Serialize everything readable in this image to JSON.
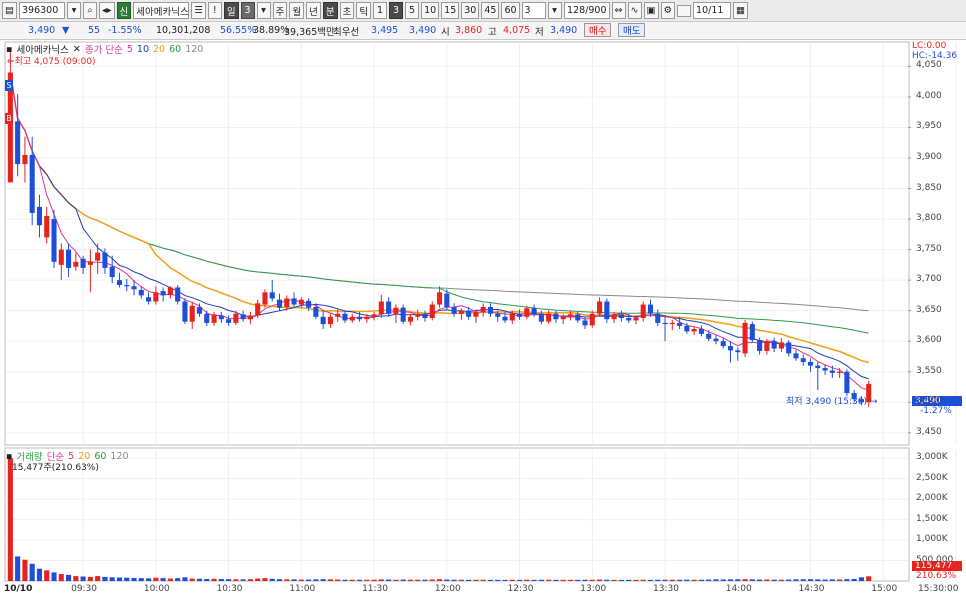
{
  "toolbar": {
    "code": "396300",
    "name": "세아메카닉스",
    "badge": "신",
    "alert": "!",
    "period_day": "일",
    "period_num": "3",
    "periods": [
      "주",
      "월",
      "년"
    ],
    "minute_label": "분",
    "intervals": [
      "초",
      "틱",
      "1",
      "3",
      "5",
      "10",
      "15",
      "30",
      "45",
      "60"
    ],
    "interval_value": "3",
    "count": "128",
    "count_total": "/900",
    "date": "10/11"
  },
  "quote": {
    "price": "3,490",
    "change": "55",
    "rate": "-1.55%",
    "volume": "10,301,208",
    "ratio1": "56.55%",
    "ratio2": "38.89%",
    "amount": "39,365백만",
    "best_label": "최우선",
    "best_ask": "3,495",
    "best_bid": "3,490",
    "open_label": "시",
    "open": "3,860",
    "high_label": "고",
    "high": "4,075",
    "low_label": "저",
    "low": "3,490",
    "buy": "매수",
    "sell": "매도"
  },
  "price_panel": {
    "title": "세아메카닉스",
    "ma_label": "종가 단순",
    "ma_periods": [
      "5",
      "10",
      "20",
      "60",
      "120"
    ],
    "high_note": "최고 4,075 (09:00)",
    "low_note": "최저 3,490 (15:30)",
    "lc": "LC:0.00",
    "hc": "HC:-14.36",
    "current_price": "3,490",
    "current_rate": "-1.27%",
    "s_marker": "S",
    "b_marker": "B",
    "y_ticks": [
      "4,050",
      "4,000",
      "3,950",
      "3,900",
      "3,850",
      "3,800",
      "3,750",
      "3,700",
      "3,650",
      "3,600",
      "3,550",
      "3,500",
      "3,450"
    ]
  },
  "volume_panel": {
    "title": "거래량",
    "ma_label": "단순",
    "ma_periods": [
      "5",
      "20",
      "60",
      "120"
    ],
    "max_note": "15,477주(210.63%)",
    "current_volume": "115,477",
    "current_rate": "210.63%",
    "y_ticks": [
      "3,000K",
      "2,500K",
      "2,000K",
      "1,500K",
      "1,000K",
      "500,000"
    ]
  },
  "x_axis": {
    "date": "10/10",
    "times": [
      "09:30",
      "10:00",
      "10:30",
      "11:00",
      "11:30",
      "12:00",
      "12:30",
      "13:00",
      "13:30",
      "14:00",
      "14:30",
      "15:00",
      "15:30:00"
    ]
  },
  "colors": {
    "up": "#e8231e",
    "down": "#1d4fd8",
    "ma5": "#e0309a",
    "ma10": "#1f3fb8",
    "ma20": "#f0a01a",
    "ma60": "#2e9a4a",
    "ma120": "#8a8a8a"
  },
  "chart_data": {
    "type": "candlestick",
    "x_label": "time",
    "y_range": [
      3430,
      4090
    ],
    "interval_minutes": 3,
    "candles": [
      {
        "t": "09:00",
        "o": 3860,
        "h": 4075,
        "l": 3870,
        "c": 4040
      },
      {
        "t": "09:03",
        "o": 3960,
        "h": 4005,
        "l": 3870,
        "c": 3890
      },
      {
        "t": "09:06",
        "o": 3890,
        "h": 3935,
        "l": 3860,
        "c": 3905
      },
      {
        "t": "09:09",
        "o": 3905,
        "h": 3935,
        "l": 3790,
        "c": 3810
      },
      {
        "t": "09:12",
        "o": 3820,
        "h": 3840,
        "l": 3770,
        "c": 3790
      },
      {
        "t": "09:15",
        "o": 3770,
        "h": 3820,
        "l": 3760,
        "c": 3805
      },
      {
        "t": "09:18",
        "o": 3800,
        "h": 3815,
        "l": 3720,
        "c": 3730
      },
      {
        "t": "09:21",
        "o": 3725,
        "h": 3760,
        "l": 3700,
        "c": 3750
      },
      {
        "t": "09:24",
        "o": 3750,
        "h": 3760,
        "l": 3705,
        "c": 3720
      },
      {
        "t": "09:27",
        "o": 3722,
        "h": 3745,
        "l": 3715,
        "c": 3730
      },
      {
        "t": "09:30",
        "o": 3735,
        "h": 3740,
        "l": 3710,
        "c": 3720
      },
      {
        "t": "09:33",
        "o": 3725,
        "h": 3750,
        "l": 3680,
        "c": 3730
      },
      {
        "t": "09:36",
        "o": 3732,
        "h": 3760,
        "l": 3710,
        "c": 3745
      },
      {
        "t": "09:39",
        "o": 3745,
        "h": 3752,
        "l": 3710,
        "c": 3720
      },
      {
        "t": "09:42",
        "o": 3722,
        "h": 3740,
        "l": 3695,
        "c": 3705
      },
      {
        "t": "09:45",
        "o": 3700,
        "h": 3712,
        "l": 3688,
        "c": 3692
      },
      {
        "t": "09:48",
        "o": 3692,
        "h": 3702,
        "l": 3682,
        "c": 3690
      },
      {
        "t": "09:51",
        "o": 3690,
        "h": 3700,
        "l": 3675,
        "c": 3685
      },
      {
        "t": "09:54",
        "o": 3684,
        "h": 3690,
        "l": 3670,
        "c": 3675
      },
      {
        "t": "09:57",
        "o": 3672,
        "h": 3680,
        "l": 3660,
        "c": 3665
      },
      {
        "t": "10:00",
        "o": 3665,
        "h": 3690,
        "l": 3660,
        "c": 3680
      },
      {
        "t": "10:03",
        "o": 3682,
        "h": 3688,
        "l": 3665,
        "c": 3675
      },
      {
        "t": "10:06",
        "o": 3676,
        "h": 3690,
        "l": 3670,
        "c": 3688
      },
      {
        "t": "10:09",
        "o": 3688,
        "h": 3692,
        "l": 3660,
        "c": 3665
      },
      {
        "t": "10:12",
        "o": 3665,
        "h": 3670,
        "l": 3628,
        "c": 3632
      },
      {
        "t": "10:15",
        "o": 3632,
        "h": 3665,
        "l": 3620,
        "c": 3658
      },
      {
        "t": "10:18",
        "o": 3656,
        "h": 3662,
        "l": 3640,
        "c": 3645
      },
      {
        "t": "10:21",
        "o": 3645,
        "h": 3650,
        "l": 3625,
        "c": 3630
      },
      {
        "t": "10:24",
        "o": 3630,
        "h": 3648,
        "l": 3625,
        "c": 3644
      },
      {
        "t": "10:27",
        "o": 3642,
        "h": 3648,
        "l": 3630,
        "c": 3636
      },
      {
        "t": "10:30",
        "o": 3636,
        "h": 3642,
        "l": 3625,
        "c": 3630
      },
      {
        "t": "10:33",
        "o": 3630,
        "h": 3650,
        "l": 3626,
        "c": 3645
      },
      {
        "t": "10:36",
        "o": 3644,
        "h": 3650,
        "l": 3632,
        "c": 3636
      },
      {
        "t": "10:39",
        "o": 3636,
        "h": 3648,
        "l": 3628,
        "c": 3642
      },
      {
        "t": "10:42",
        "o": 3642,
        "h": 3668,
        "l": 3638,
        "c": 3662
      },
      {
        "t": "10:45",
        "o": 3660,
        "h": 3685,
        "l": 3655,
        "c": 3680
      },
      {
        "t": "10:48",
        "o": 3680,
        "h": 3700,
        "l": 3665,
        "c": 3670
      },
      {
        "t": "10:51",
        "o": 3668,
        "h": 3678,
        "l": 3650,
        "c": 3655
      },
      {
        "t": "10:54",
        "o": 3656,
        "h": 3675,
        "l": 3650,
        "c": 3670
      },
      {
        "t": "10:57",
        "o": 3670,
        "h": 3680,
        "l": 3655,
        "c": 3660
      },
      {
        "t": "11:00",
        "o": 3660,
        "h": 3672,
        "l": 3655,
        "c": 3668
      },
      {
        "t": "11:03",
        "o": 3666,
        "h": 3670,
        "l": 3650,
        "c": 3655
      },
      {
        "t": "11:06",
        "o": 3656,
        "h": 3662,
        "l": 3636,
        "c": 3640
      },
      {
        "t": "11:09",
        "o": 3640,
        "h": 3650,
        "l": 3620,
        "c": 3628
      },
      {
        "t": "11:12",
        "o": 3628,
        "h": 3645,
        "l": 3622,
        "c": 3640
      },
      {
        "t": "11:15",
        "o": 3640,
        "h": 3652,
        "l": 3632,
        "c": 3645
      },
      {
        "t": "11:18",
        "o": 3645,
        "h": 3650,
        "l": 3630,
        "c": 3634
      },
      {
        "t": "11:21",
        "o": 3634,
        "h": 3645,
        "l": 3630,
        "c": 3640
      },
      {
        "t": "11:24",
        "o": 3640,
        "h": 3648,
        "l": 3632,
        "c": 3636
      },
      {
        "t": "11:27",
        "o": 3636,
        "h": 3644,
        "l": 3630,
        "c": 3640
      },
      {
        "t": "11:30",
        "o": 3640,
        "h": 3648,
        "l": 3634,
        "c": 3644
      },
      {
        "t": "11:33",
        "o": 3644,
        "h": 3676,
        "l": 3638,
        "c": 3665
      },
      {
        "t": "11:36",
        "o": 3665,
        "h": 3672,
        "l": 3640,
        "c": 3645
      },
      {
        "t": "11:39",
        "o": 3645,
        "h": 3660,
        "l": 3630,
        "c": 3655
      },
      {
        "t": "11:42",
        "o": 3655,
        "h": 3660,
        "l": 3628,
        "c": 3632
      },
      {
        "t": "11:45",
        "o": 3632,
        "h": 3645,
        "l": 3626,
        "c": 3640
      },
      {
        "t": "11:48",
        "o": 3640,
        "h": 3652,
        "l": 3634,
        "c": 3644
      },
      {
        "t": "11:51",
        "o": 3644,
        "h": 3650,
        "l": 3632,
        "c": 3638
      },
      {
        "t": "11:54",
        "o": 3638,
        "h": 3665,
        "l": 3634,
        "c": 3660
      },
      {
        "t": "11:57",
        "o": 3660,
        "h": 3690,
        "l": 3655,
        "c": 3680
      },
      {
        "t": "12:00",
        "o": 3678,
        "h": 3685,
        "l": 3652,
        "c": 3656
      },
      {
        "t": "12:03",
        "o": 3656,
        "h": 3662,
        "l": 3640,
        "c": 3645
      },
      {
        "t": "12:06",
        "o": 3645,
        "h": 3654,
        "l": 3635,
        "c": 3650
      },
      {
        "t": "12:09",
        "o": 3650,
        "h": 3656,
        "l": 3635,
        "c": 3640
      },
      {
        "t": "12:12",
        "o": 3640,
        "h": 3652,
        "l": 3630,
        "c": 3648
      },
      {
        "t": "12:15",
        "o": 3648,
        "h": 3662,
        "l": 3640,
        "c": 3656
      },
      {
        "t": "12:18",
        "o": 3656,
        "h": 3662,
        "l": 3640,
        "c": 3645
      },
      {
        "t": "12:21",
        "o": 3645,
        "h": 3650,
        "l": 3632,
        "c": 3640
      },
      {
        "t": "12:24",
        "o": 3640,
        "h": 3648,
        "l": 3630,
        "c": 3634
      },
      {
        "t": "12:27",
        "o": 3634,
        "h": 3650,
        "l": 3628,
        "c": 3645
      },
      {
        "t": "12:30",
        "o": 3645,
        "h": 3652,
        "l": 3635,
        "c": 3640
      },
      {
        "t": "12:33",
        "o": 3640,
        "h": 3658,
        "l": 3636,
        "c": 3654
      },
      {
        "t": "12:36",
        "o": 3654,
        "h": 3660,
        "l": 3640,
        "c": 3645
      },
      {
        "t": "12:39",
        "o": 3645,
        "h": 3650,
        "l": 3628,
        "c": 3632
      },
      {
        "t": "12:42",
        "o": 3632,
        "h": 3650,
        "l": 3628,
        "c": 3645
      },
      {
        "t": "12:45",
        "o": 3645,
        "h": 3650,
        "l": 3630,
        "c": 3636
      },
      {
        "t": "12:48",
        "o": 3636,
        "h": 3644,
        "l": 3628,
        "c": 3640
      },
      {
        "t": "12:51",
        "o": 3640,
        "h": 3650,
        "l": 3634,
        "c": 3644
      },
      {
        "t": "12:54",
        "o": 3644,
        "h": 3648,
        "l": 3630,
        "c": 3634
      },
      {
        "t": "12:57",
        "o": 3634,
        "h": 3640,
        "l": 3620,
        "c": 3626
      },
      {
        "t": "13:00",
        "o": 3626,
        "h": 3650,
        "l": 3622,
        "c": 3645
      },
      {
        "t": "13:03",
        "o": 3645,
        "h": 3672,
        "l": 3640,
        "c": 3665
      },
      {
        "t": "13:06",
        "o": 3665,
        "h": 3670,
        "l": 3630,
        "c": 3636
      },
      {
        "t": "13:09",
        "o": 3636,
        "h": 3648,
        "l": 3630,
        "c": 3644
      },
      {
        "t": "13:12",
        "o": 3644,
        "h": 3650,
        "l": 3632,
        "c": 3638
      },
      {
        "t": "13:15",
        "o": 3638,
        "h": 3644,
        "l": 3630,
        "c": 3634
      },
      {
        "t": "13:18",
        "o": 3634,
        "h": 3642,
        "l": 3628,
        "c": 3638
      },
      {
        "t": "13:21",
        "o": 3638,
        "h": 3665,
        "l": 3632,
        "c": 3660
      },
      {
        "t": "13:24",
        "o": 3660,
        "h": 3668,
        "l": 3640,
        "c": 3645
      },
      {
        "t": "13:27",
        "o": 3645,
        "h": 3652,
        "l": 3625,
        "c": 3630
      },
      {
        "t": "13:30",
        "o": 3630,
        "h": 3640,
        "l": 3600,
        "c": 3628
      },
      {
        "t": "13:33",
        "o": 3628,
        "h": 3635,
        "l": 3618,
        "c": 3630
      },
      {
        "t": "13:36",
        "o": 3630,
        "h": 3640,
        "l": 3620,
        "c": 3625
      },
      {
        "t": "13:39",
        "o": 3625,
        "h": 3630,
        "l": 3612,
        "c": 3616
      },
      {
        "t": "13:42",
        "o": 3616,
        "h": 3624,
        "l": 3610,
        "c": 3620
      },
      {
        "t": "13:45",
        "o": 3620,
        "h": 3626,
        "l": 3608,
        "c": 3612
      },
      {
        "t": "13:48",
        "o": 3612,
        "h": 3618,
        "l": 3600,
        "c": 3604
      },
      {
        "t": "13:51",
        "o": 3604,
        "h": 3610,
        "l": 3595,
        "c": 3600
      },
      {
        "t": "13:54",
        "o": 3600,
        "h": 3606,
        "l": 3588,
        "c": 3592
      },
      {
        "t": "13:57",
        "o": 3592,
        "h": 3600,
        "l": 3565,
        "c": 3585
      },
      {
        "t": "14:00",
        "o": 3585,
        "h": 3590,
        "l": 3568,
        "c": 3582
      },
      {
        "t": "14:03",
        "o": 3580,
        "h": 3635,
        "l": 3574,
        "c": 3630
      },
      {
        "t": "14:06",
        "o": 3628,
        "h": 3632,
        "l": 3598,
        "c": 3602
      },
      {
        "t": "14:09",
        "o": 3602,
        "h": 3606,
        "l": 3578,
        "c": 3584
      },
      {
        "t": "14:12",
        "o": 3584,
        "h": 3604,
        "l": 3578,
        "c": 3600
      },
      {
        "t": "14:15",
        "o": 3600,
        "h": 3606,
        "l": 3582,
        "c": 3588
      },
      {
        "t": "14:18",
        "o": 3588,
        "h": 3605,
        "l": 3582,
        "c": 3598
      },
      {
        "t": "14:21",
        "o": 3598,
        "h": 3602,
        "l": 3575,
        "c": 3580
      },
      {
        "t": "14:24",
        "o": 3580,
        "h": 3586,
        "l": 3568,
        "c": 3572
      },
      {
        "t": "14:27",
        "o": 3572,
        "h": 3578,
        "l": 3560,
        "c": 3566
      },
      {
        "t": "14:30",
        "o": 3566,
        "h": 3572,
        "l": 3550,
        "c": 3560
      },
      {
        "t": "14:33",
        "o": 3560,
        "h": 3566,
        "l": 3520,
        "c": 3556
      },
      {
        "t": "14:36",
        "o": 3556,
        "h": 3562,
        "l": 3545,
        "c": 3552
      },
      {
        "t": "14:39",
        "o": 3552,
        "h": 3560,
        "l": 3540,
        "c": 3548
      },
      {
        "t": "14:42",
        "o": 3548,
        "h": 3556,
        "l": 3540,
        "c": 3550
      },
      {
        "t": "14:45",
        "o": 3550,
        "h": 3554,
        "l": 3510,
        "c": 3515
      },
      {
        "t": "14:48",
        "o": 3515,
        "h": 3520,
        "l": 3500,
        "c": 3505
      },
      {
        "t": "14:51",
        "o": 3505,
        "h": 3510,
        "l": 3495,
        "c": 3500
      },
      {
        "t": "14:54",
        "o": 3500,
        "h": 3535,
        "l": 3492,
        "c": 3530
      }
    ],
    "volumes": [
      3000,
      600,
      520,
      420,
      300,
      260,
      210,
      170,
      150,
      120,
      110,
      100,
      120,
      100,
      90,
      85,
      80,
      75,
      70,
      65,
      80,
      70,
      60,
      70,
      90,
      60,
      55,
      50,
      55,
      50,
      45,
      40,
      40,
      45,
      60,
      70,
      55,
      45,
      40,
      40,
      35,
      35,
      40,
      45,
      40,
      35,
      30,
      30,
      30,
      30,
      30,
      40,
      35,
      30,
      35,
      30,
      30,
      30,
      35,
      45,
      35,
      30,
      30,
      28,
      30,
      30,
      28,
      28,
      28,
      30,
      28,
      30,
      28,
      30,
      30,
      28,
      28,
      28,
      28,
      30,
      30,
      35,
      30,
      28,
      28,
      28,
      28,
      30,
      28,
      30,
      30,
      30,
      30,
      32,
      30,
      30,
      35,
      40,
      38,
      40,
      42,
      45,
      40,
      35,
      35,
      32,
      30,
      35,
      40,
      42,
      45,
      40,
      35,
      40,
      38,
      45,
      50,
      90,
      115
    ]
  }
}
